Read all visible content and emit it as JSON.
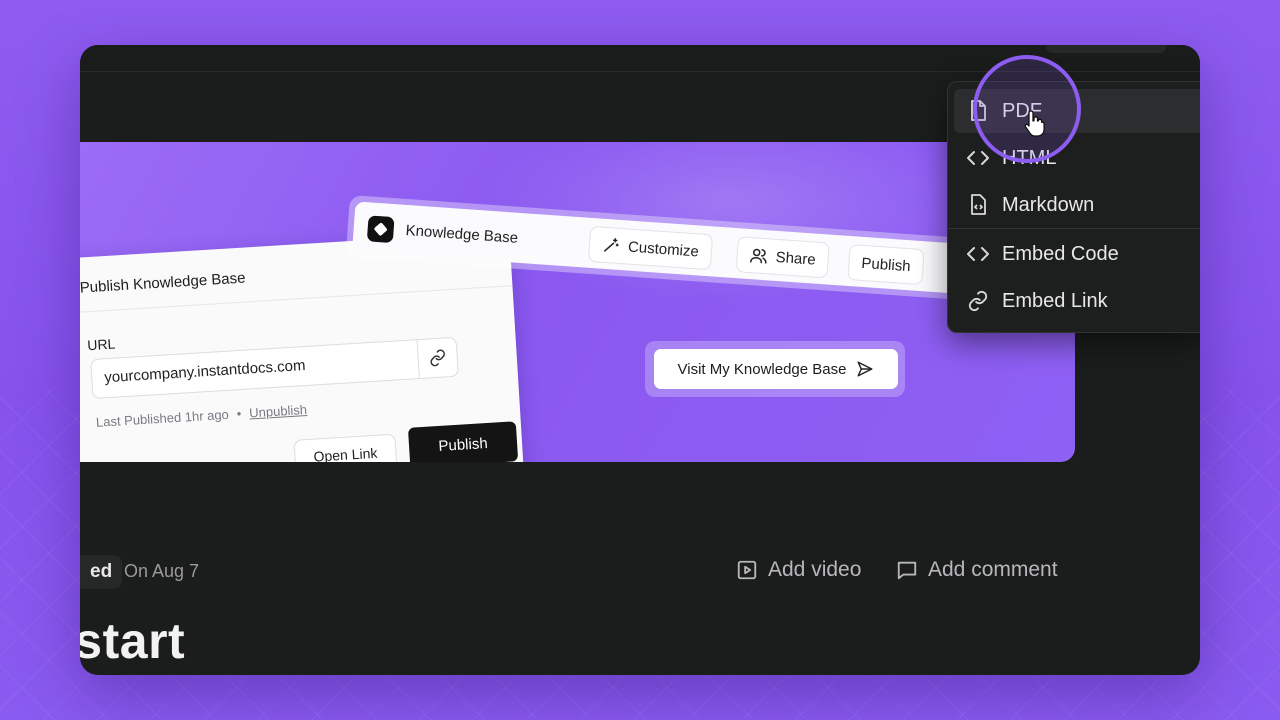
{
  "hero": {
    "publish_card": {
      "title": "Publish Knowledge Base",
      "url_label": "URL",
      "url_value": "yourcompany.instantdocs.com",
      "last_published": "Last Published 1hr ago",
      "separator": "•",
      "unpublish_label": "Unpublish",
      "open_link_label": "Open Link",
      "publish_label": "Publish"
    },
    "toolbar": {
      "title": "Knowledge Base",
      "customize_label": "Customize",
      "share_label": "Share",
      "publish_label": "Publish"
    },
    "visit_button_label": "Visit My Knowledge Base"
  },
  "export_menu": {
    "items": [
      {
        "label": "PDF",
        "icon": "file-icon",
        "active": true
      },
      {
        "label": "HTML",
        "icon": "code-icon"
      },
      {
        "label": "Markdown",
        "icon": "markdown-file-icon"
      },
      {
        "label": "Embed Code",
        "icon": "code-icon"
      },
      {
        "label": "Embed Link",
        "icon": "link-icon"
      }
    ]
  },
  "doc": {
    "status_label": "ed",
    "date_label": "On Aug 7",
    "add_video_label": "Add video",
    "add_comment_label": "Add comment",
    "title": "kstart"
  },
  "colors": {
    "accent": "#8d5cf0",
    "window_bg": "#1b1c1c",
    "menu_bg": "#1d1e1e"
  }
}
